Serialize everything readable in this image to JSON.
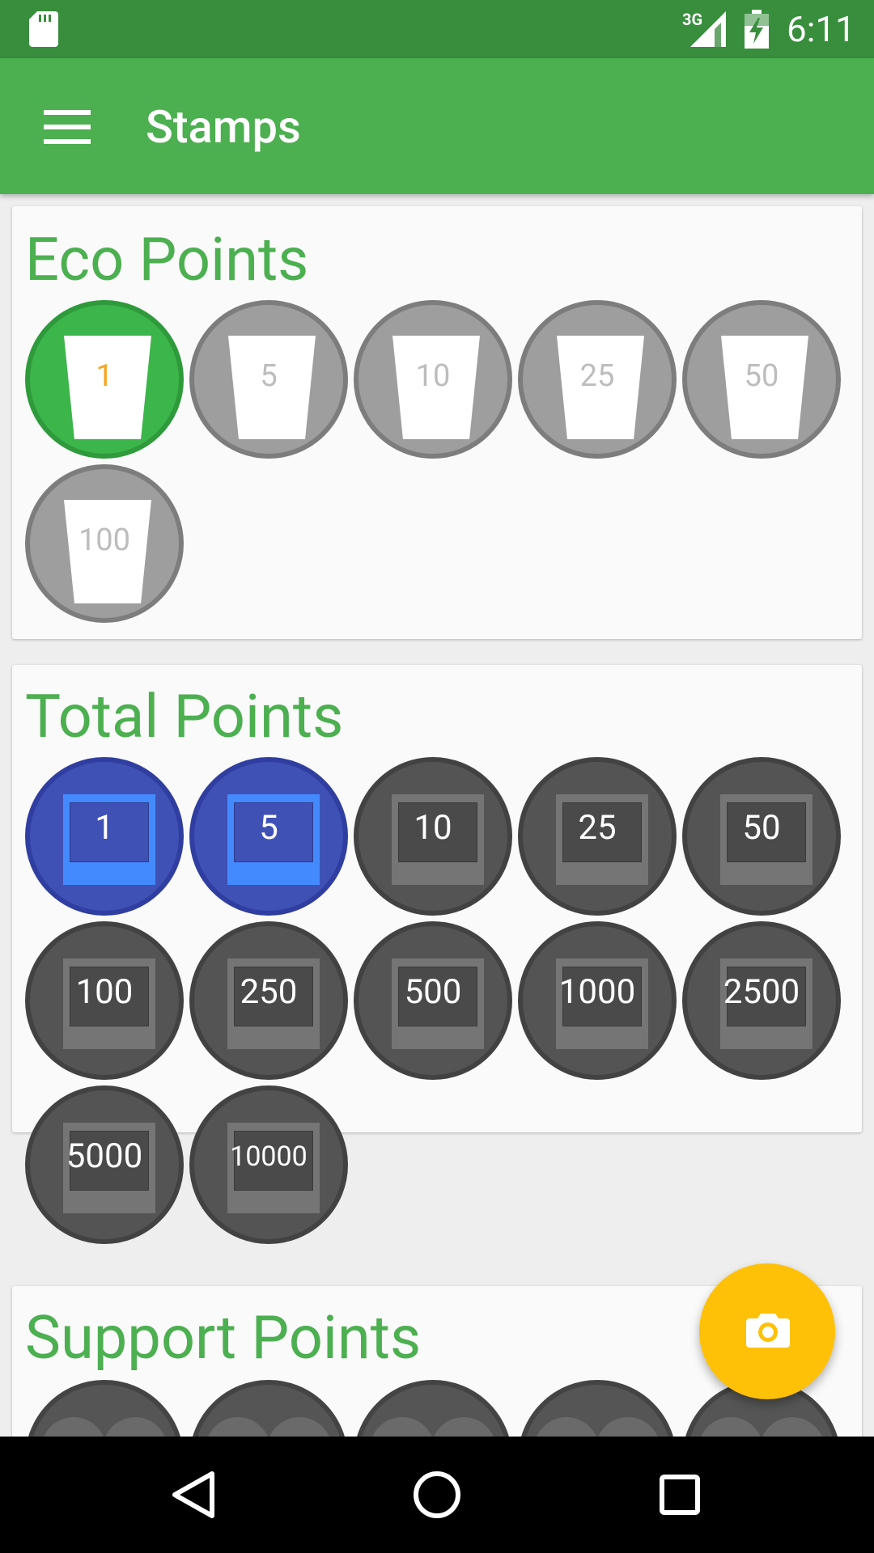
{
  "status_bar": {
    "network": "3G",
    "time": "6:11"
  },
  "app_bar": {
    "title": "Stamps"
  },
  "sections": {
    "eco": {
      "title": "Eco Points",
      "stamps": [
        {
          "label": "1",
          "earned": true
        },
        {
          "label": "5",
          "earned": false
        },
        {
          "label": "10",
          "earned": false
        },
        {
          "label": "25",
          "earned": false
        },
        {
          "label": "50",
          "earned": false
        },
        {
          "label": "100",
          "earned": false
        }
      ]
    },
    "total": {
      "title": "Total Points",
      "stamps": [
        {
          "label": "1",
          "earned": true
        },
        {
          "label": "5",
          "earned": true
        },
        {
          "label": "10",
          "earned": false
        },
        {
          "label": "25",
          "earned": false
        },
        {
          "label": "50",
          "earned": false
        },
        {
          "label": "100",
          "earned": false
        },
        {
          "label": "250",
          "earned": false
        },
        {
          "label": "500",
          "earned": false
        },
        {
          "label": "1000",
          "earned": false
        },
        {
          "label": "2500",
          "earned": false
        },
        {
          "label": "5000",
          "earned": false
        },
        {
          "label": "10000",
          "earned": false
        }
      ]
    },
    "support": {
      "title": "Support Points"
    }
  },
  "colors": {
    "primary": "#4caf50",
    "primary_dark": "#388e3c",
    "accent": "#ffc107",
    "earned_total": "#3f51b5"
  },
  "icons": {
    "menu": "menu-icon",
    "fab": "camera-icon",
    "nav": [
      "back-icon",
      "home-icon",
      "recents-icon"
    ]
  }
}
